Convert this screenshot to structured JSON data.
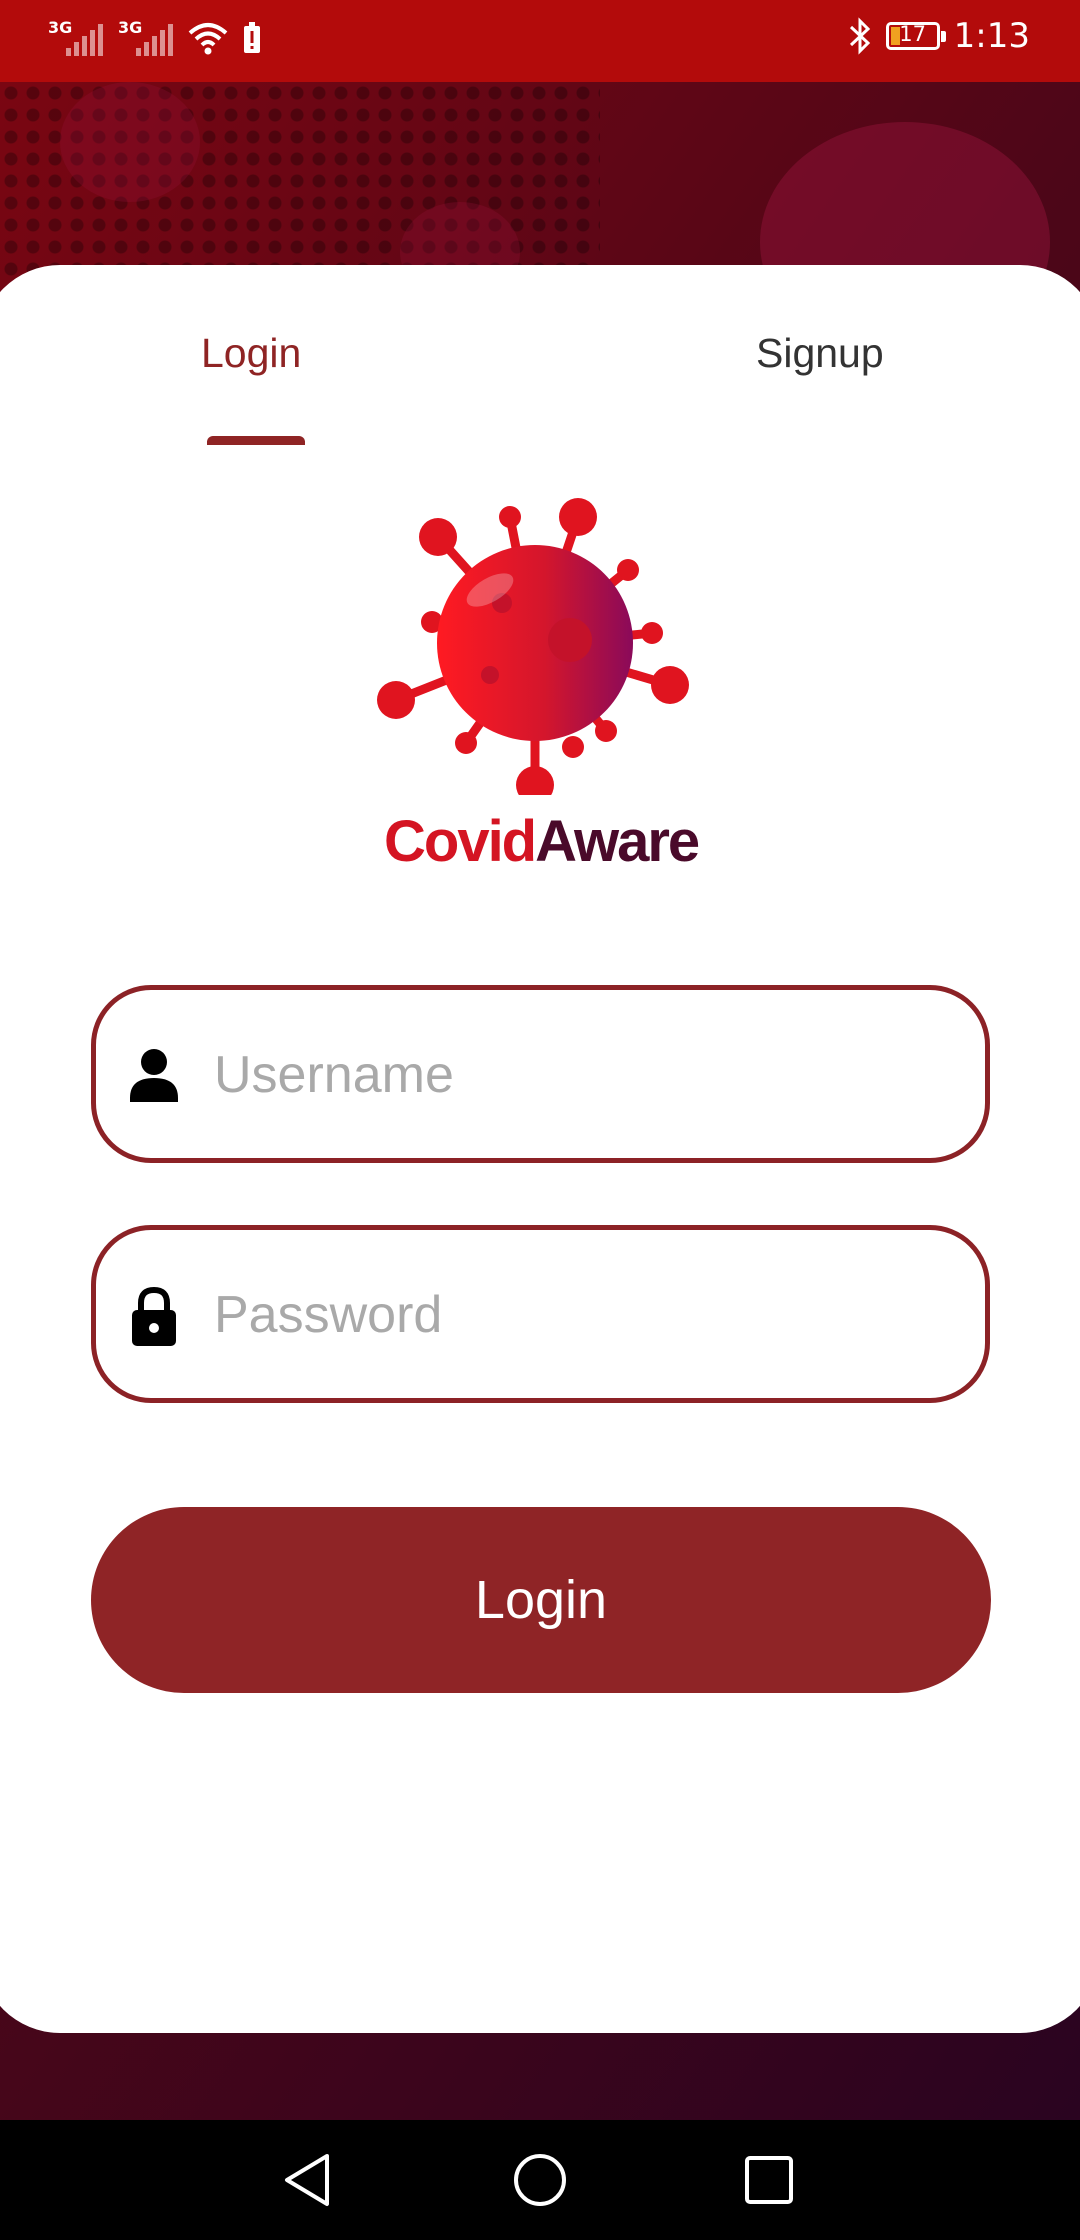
{
  "status_bar": {
    "network_1": "3G",
    "network_2": "3G",
    "battery_level": "17",
    "time": "1:13"
  },
  "tabs": {
    "login_label": "Login",
    "signup_label": "Signup",
    "active": "Login"
  },
  "logo": {
    "part1": "Covid",
    "part2": "Aware"
  },
  "form": {
    "username_placeholder": "Username",
    "username_value": "",
    "password_placeholder": "Password",
    "password_value": "",
    "submit_label": "Login"
  },
  "icons": {
    "username": "person-icon",
    "password": "lock-icon",
    "nav_back": "back-triangle-icon",
    "nav_home": "home-circle-icon",
    "nav_recent": "recent-square-icon"
  },
  "colors": {
    "status_bar": "#b30b0b",
    "accent": "#8f2424",
    "logo_red": "#d41422",
    "logo_dark": "#4a0a2a"
  }
}
